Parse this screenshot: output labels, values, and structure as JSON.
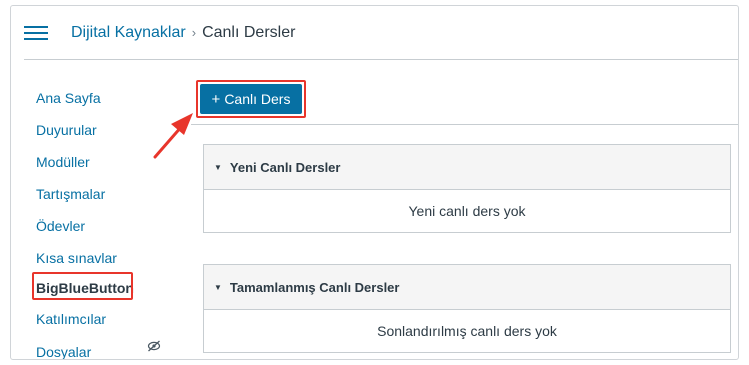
{
  "breadcrumb": {
    "parent": "Dijital Kaynaklar",
    "separator": "›",
    "current": "Canlı Dersler"
  },
  "sidebar": {
    "items": [
      {
        "label": "Ana Sayfa"
      },
      {
        "label": "Duyurular"
      },
      {
        "label": "Modüller"
      },
      {
        "label": "Tartışmalar"
      },
      {
        "label": "Ödevler"
      },
      {
        "label": "Kısa sınavlar"
      },
      {
        "label": "BigBlueButton"
      },
      {
        "label": "Katılımcılar"
      },
      {
        "label": "Dosyalar"
      }
    ],
    "active_index": 6
  },
  "toolbar": {
    "add_icon": "+",
    "add_label": "Canlı Ders"
  },
  "sections": [
    {
      "title": "Yeni Canlı Dersler",
      "empty_text": "Yeni canlı ders yok"
    },
    {
      "title": "Tamamlanmış Canlı Dersler",
      "empty_text": "Sonlandırılmış canlı ders yok"
    }
  ],
  "icons": {
    "menu": "hamburger-icon",
    "caret": "caret-down-icon",
    "hidden": "eye-slash-icon"
  },
  "colors": {
    "link": "#0770a3",
    "primary_button": "#0770a3",
    "annotation": "#e8352b",
    "section_header_bg": "#f5f5f5"
  }
}
